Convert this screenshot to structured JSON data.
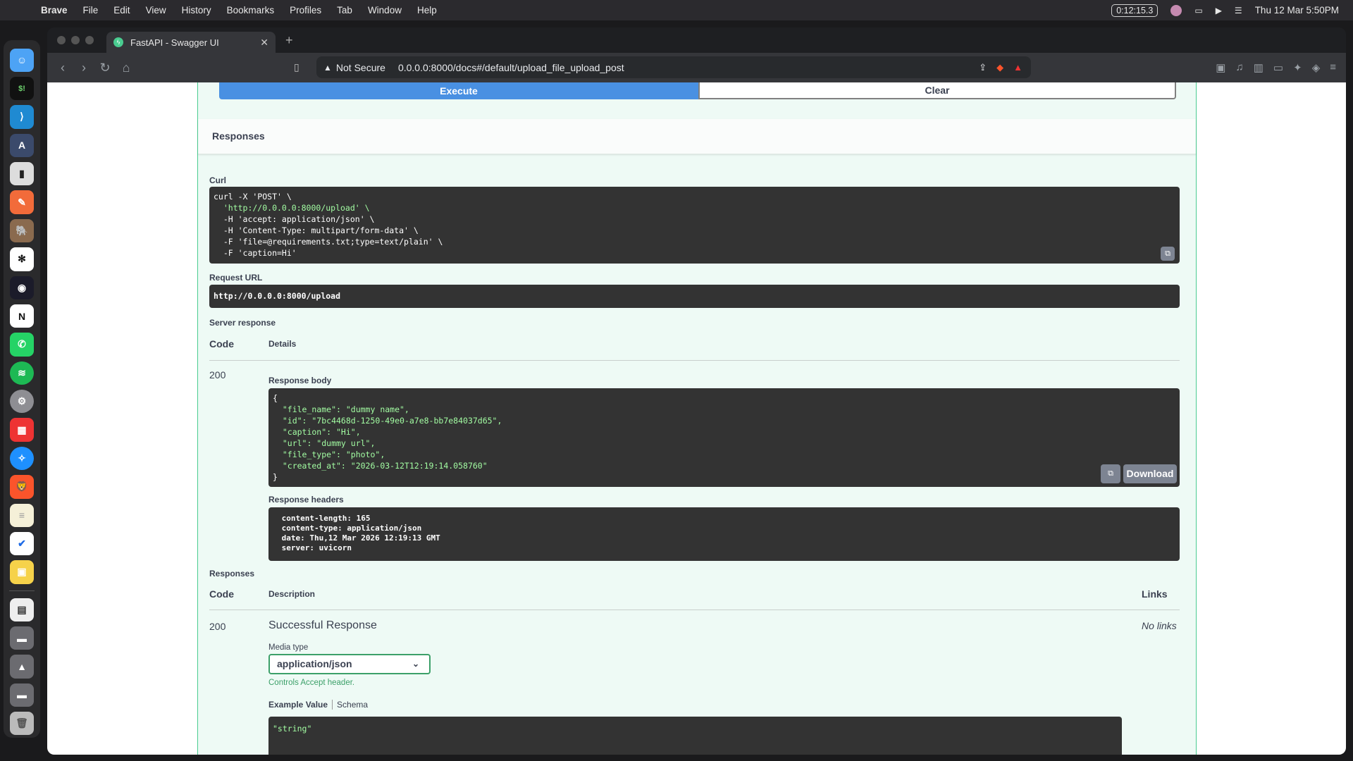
{
  "menubar": {
    "app": "Brave",
    "items": [
      "File",
      "Edit",
      "View",
      "History",
      "Bookmarks",
      "Profiles",
      "Tab",
      "Window",
      "Help"
    ],
    "timer": "0:12:15.3",
    "datetime": "Thu 12 Mar  5:50PM"
  },
  "browser": {
    "tab_title": "FastAPI - Swagger UI",
    "not_secure": "Not Secure",
    "url": "0.0.0.0:8000/docs#/default/upload_file_upload_post"
  },
  "execute": {
    "execute_label": "Execute",
    "clear_label": "Clear"
  },
  "responses_title": "Responses",
  "curl": {
    "label": "Curl",
    "lines": [
      "curl -X 'POST' \\",
      "  'http://0.0.0.0:8000/upload' \\",
      "  -H 'accept: application/json' \\",
      "  -H 'Content-Type: multipart/form-data' \\",
      "  -F 'file=@requirements.txt;type=text/plain' \\",
      "  -F 'caption=Hi'"
    ]
  },
  "request_url": {
    "label": "Request URL",
    "value": "http://0.0.0.0:8000/upload"
  },
  "server_response": {
    "label": "Server response",
    "col_code": "Code",
    "col_details": "Details",
    "code": "200",
    "body_label": "Response body",
    "body_lines": [
      "{",
      "  \"file_name\": \"dummy name\",",
      "  \"id\": \"7bc4468d-1250-49e0-a7e8-bb7e84037d65\",",
      "  \"caption\": \"Hi\",",
      "  \"url\": \"dummy url\",",
      "  \"file_type\": \"photo\",",
      "  \"created_at\": \"2026-03-12T12:19:14.058760\"",
      "}"
    ],
    "download_label": "Download",
    "headers_label": "Response headers",
    "header_lines": [
      " content-length: 165 ",
      " content-type: application/json ",
      " date: Thu,12 Mar 2026 12:19:13 GMT ",
      " server: uvicorn "
    ]
  },
  "responses_table": {
    "label": "Responses",
    "col_code": "Code",
    "col_description": "Description",
    "col_links": "Links",
    "code": "200",
    "description": "Successful Response",
    "links": "No links",
    "media_type_label": "Media type",
    "media_type_value": "application/json",
    "media_hint": "Controls Accept header.",
    "example_tab": "Example Value",
    "schema_tab": "Schema",
    "example_value": "\"string\""
  }
}
